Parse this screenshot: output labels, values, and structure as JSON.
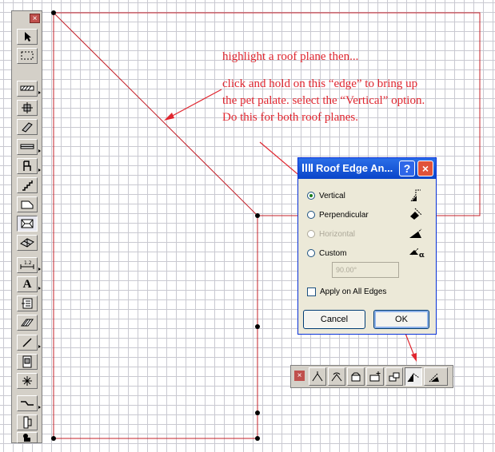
{
  "annotations": {
    "note1": "highlight a roof plane then...",
    "note2": "click and hold on this “edge” to bring up the pet palate. select the “Vertical” option. Do this for both roof planes."
  },
  "toolbox": {
    "close_label": "×",
    "tools": [
      "arrow-icon",
      "marquee-icon",
      "wall-icon",
      "column-icon",
      "beam-icon",
      "window-icon",
      "chair-icon",
      "stair-icon",
      "slab-icon",
      "roof-icon",
      "mesh-icon",
      "dimension-icon",
      "text-icon",
      "label-icon",
      "fill-icon",
      "line-icon",
      "picture-icon",
      "hotspot-icon",
      "polyline-icon",
      "door-icon",
      "camera-icon"
    ],
    "text_tool_label": "A"
  },
  "dialog": {
    "title": "Roof Edge An...",
    "help_label": "?",
    "close_label": "×",
    "options": [
      {
        "label": "Vertical",
        "selected": true,
        "enabled": true
      },
      {
        "label": "Perpendicular",
        "selected": false,
        "enabled": true
      },
      {
        "label": "Horizontal",
        "selected": false,
        "enabled": false
      },
      {
        "label": "Custom",
        "selected": false,
        "enabled": true
      }
    ],
    "angle_value": "90.00°",
    "apply_all_label": "Apply on All Edges",
    "apply_all_checked": false,
    "cancel_label": "Cancel",
    "ok_label": "OK"
  },
  "pet_palette": {
    "close_label": "×",
    "buttons": [
      "pet-stretch-icon",
      "pet-rotate-icon",
      "pet-offset-icon",
      "pet-add-node-icon",
      "pet-subtract-icon",
      "pet-edge-angle-icon",
      "pet-curve-icon"
    ],
    "selected_index": 5
  },
  "colors": {
    "annotation": "#e0262f",
    "roof_line": "#c4202a",
    "grid": "#c9c9d1",
    "title_bar": "#0a45c9"
  }
}
